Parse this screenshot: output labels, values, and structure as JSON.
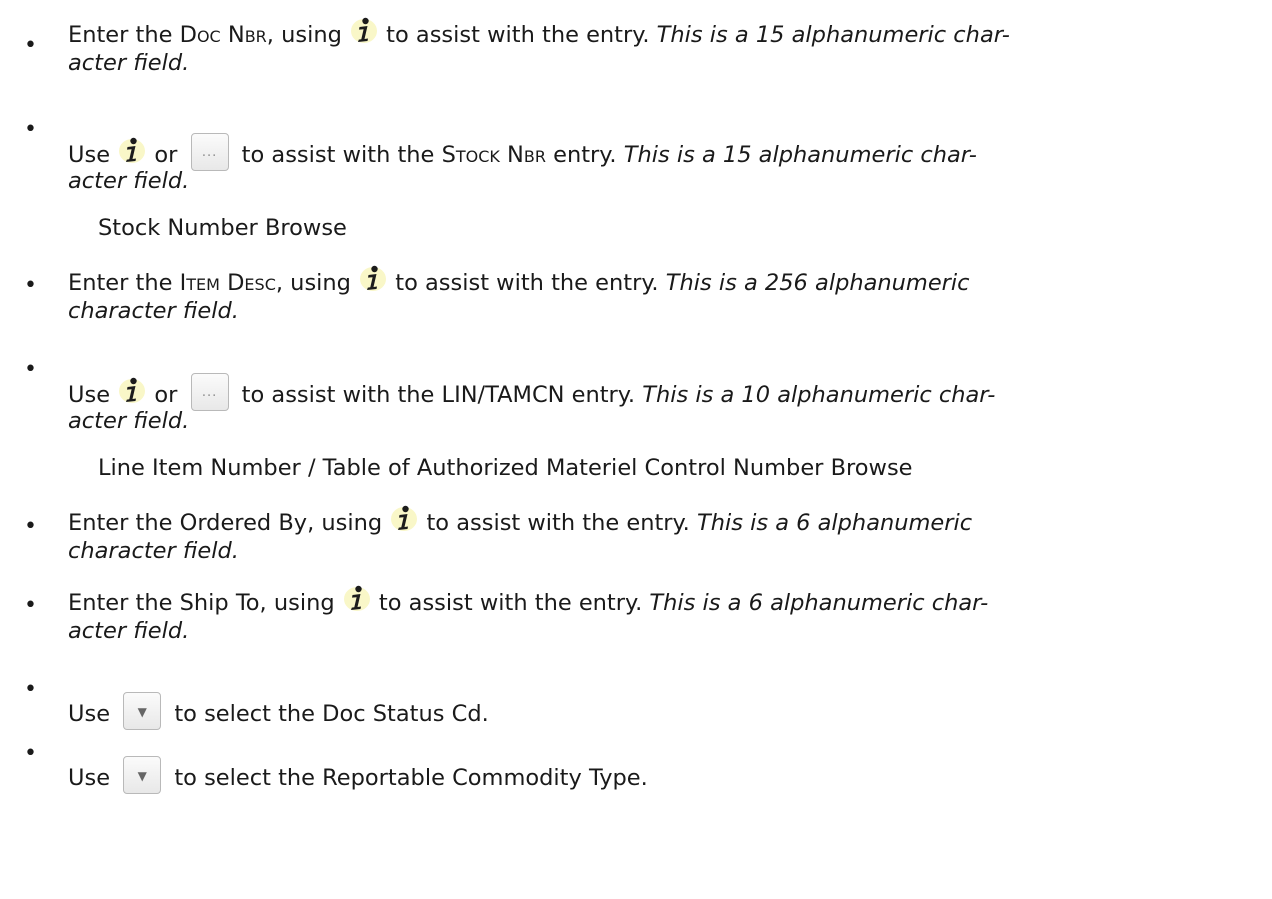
{
  "items": [
    {
      "bullet": "•",
      "line1": {
        "a": "Enter the ",
        "field": "Doc Nbr",
        "b": ", using ",
        "c": " to assist with the entry. ",
        "italic": "This is a 15 alphanumeric char-"
      },
      "line2_italic": "acter field."
    },
    {
      "bullet": "•",
      "line1": {
        "a": "Use ",
        "or": " or ",
        "c": " to assist with the ",
        "field": "Stock Nbr",
        "d": " entry. ",
        "italic": "This is a 15 alphanumeric char-"
      },
      "line2_italic": "acter field.",
      "note": "Stock Number Browse"
    },
    {
      "bullet": "•",
      "line1": {
        "a": "Enter the ",
        "field": "Item Desc",
        "b": ", using ",
        "c": " to assist with the entry. ",
        "italic": "This is a 256 alphanumeric"
      },
      "line2_italic": "character field."
    },
    {
      "bullet": "•",
      "line1": {
        "a": "Use ",
        "or": " or ",
        "c": " to assist with the LIN/TAMCN entry. ",
        "italic": "This is a 10 alphanumeric char-"
      },
      "line2_italic": "acter field.",
      "note": "Line Item Number / Table of Authorized Materiel Control Number Browse"
    },
    {
      "bullet": "•",
      "line1": {
        "a": "Enter the Ordered By, using ",
        "c": " to assist with the entry. ",
        "italic": "This is a 6 alphanumeric"
      },
      "line2_italic": "character field."
    },
    {
      "bullet": "•",
      "line1": {
        "a": "Enter the Ship To, using ",
        "c": " to assist with the entry. ",
        "italic": "This is a 6 alphanumeric char-"
      },
      "line2_italic": "acter field."
    },
    {
      "bullet": "•",
      "line1": {
        "a": "Use ",
        "c": " to select the Doc Status Cd."
      }
    },
    {
      "bullet": "•",
      "line1": {
        "a": "Use ",
        "c": " to select the Reportable Commodity Type."
      }
    }
  ],
  "icons": {
    "info": "info-icon",
    "browse": "browse-ellipsis-icon",
    "dropdown": "dropdown-arrow-icon"
  },
  "glyphs": {
    "ellipsis": "···",
    "arrow": "▼"
  },
  "colors": {
    "info_icon": "#1c1c1c",
    "info_glow": "#f7f3b0",
    "button_border": "#b9b9b9"
  }
}
